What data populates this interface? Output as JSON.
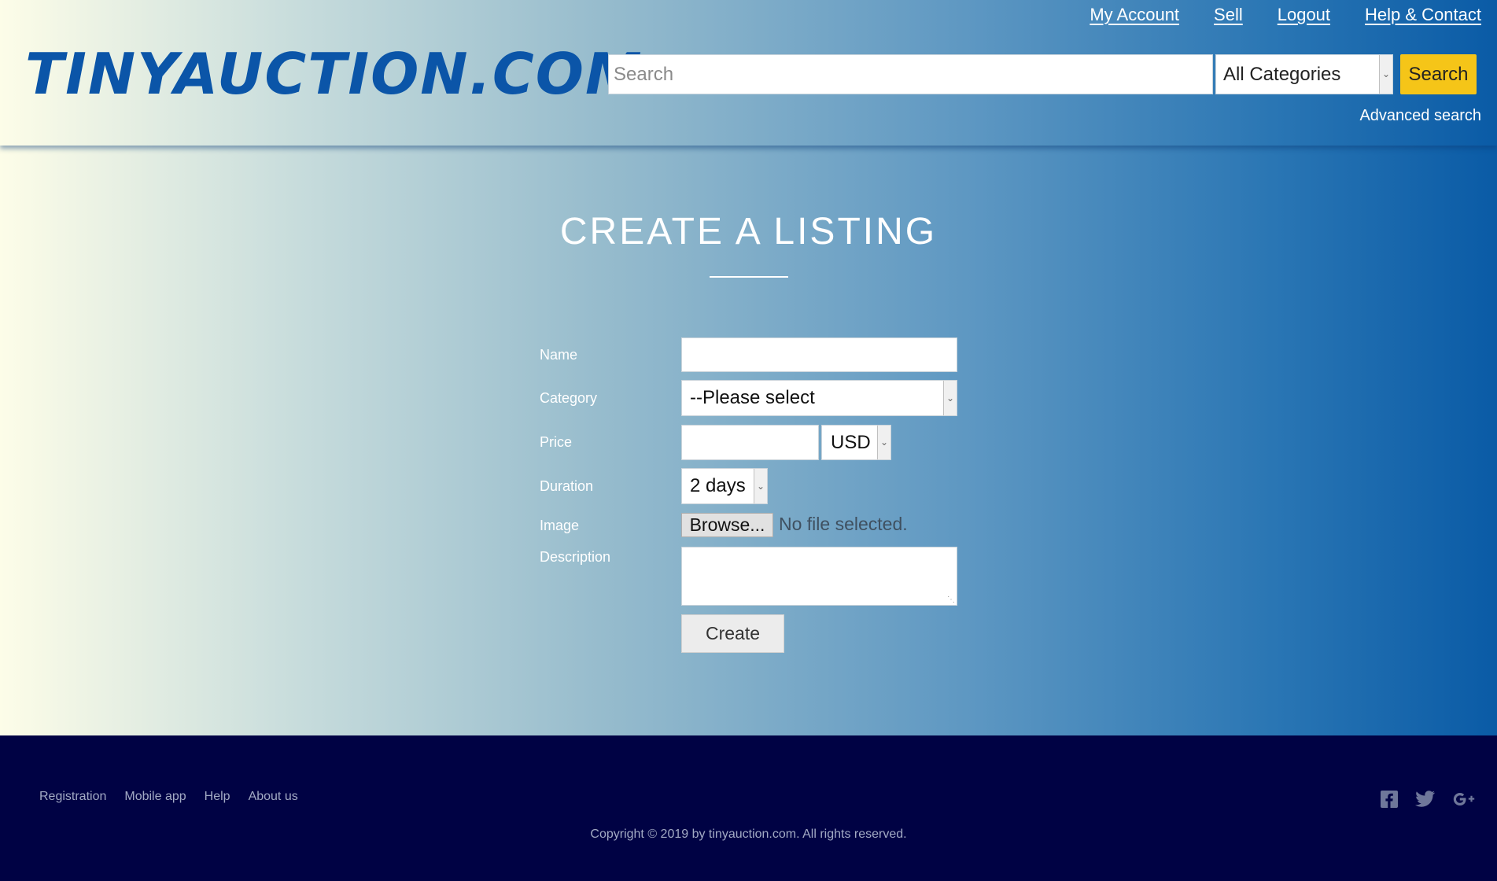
{
  "site": {
    "logo": "TINYAUCTION.COM"
  },
  "nav": {
    "items": [
      {
        "label": "My Account"
      },
      {
        "label": "Sell"
      },
      {
        "label": "Logout"
      },
      {
        "label": "Help & Contact"
      }
    ]
  },
  "search": {
    "placeholder": "Search",
    "value": "",
    "category": "All Categories",
    "button_label": "Search",
    "advanced_label": "Advanced search"
  },
  "page": {
    "title": "CREATE A LISTING"
  },
  "form": {
    "name_label": "Name",
    "name_value": "",
    "category_label": "Category",
    "category_value": "--Please select",
    "price_label": "Price",
    "price_value": "",
    "currency_value": "USD",
    "duration_label": "Duration",
    "duration_value": "2 days",
    "image_label": "Image",
    "browse_label": "Browse...",
    "file_status": "No file selected.",
    "description_label": "Description",
    "description_value": "",
    "submit_label": "Create"
  },
  "footer": {
    "links": [
      {
        "label": "Registration"
      },
      {
        "label": "Mobile app"
      },
      {
        "label": "Help"
      },
      {
        "label": "About us"
      }
    ],
    "copyright": "Copyright © 2019 by tinyauction.com. All rights reserved.",
    "social_icons": [
      "facebook-icon",
      "twitter-icon",
      "google-plus-icon"
    ]
  },
  "colors": {
    "brand_blue": "#0b55a8",
    "accent_yellow": "#f5c518",
    "footer_bg": "#000244"
  }
}
